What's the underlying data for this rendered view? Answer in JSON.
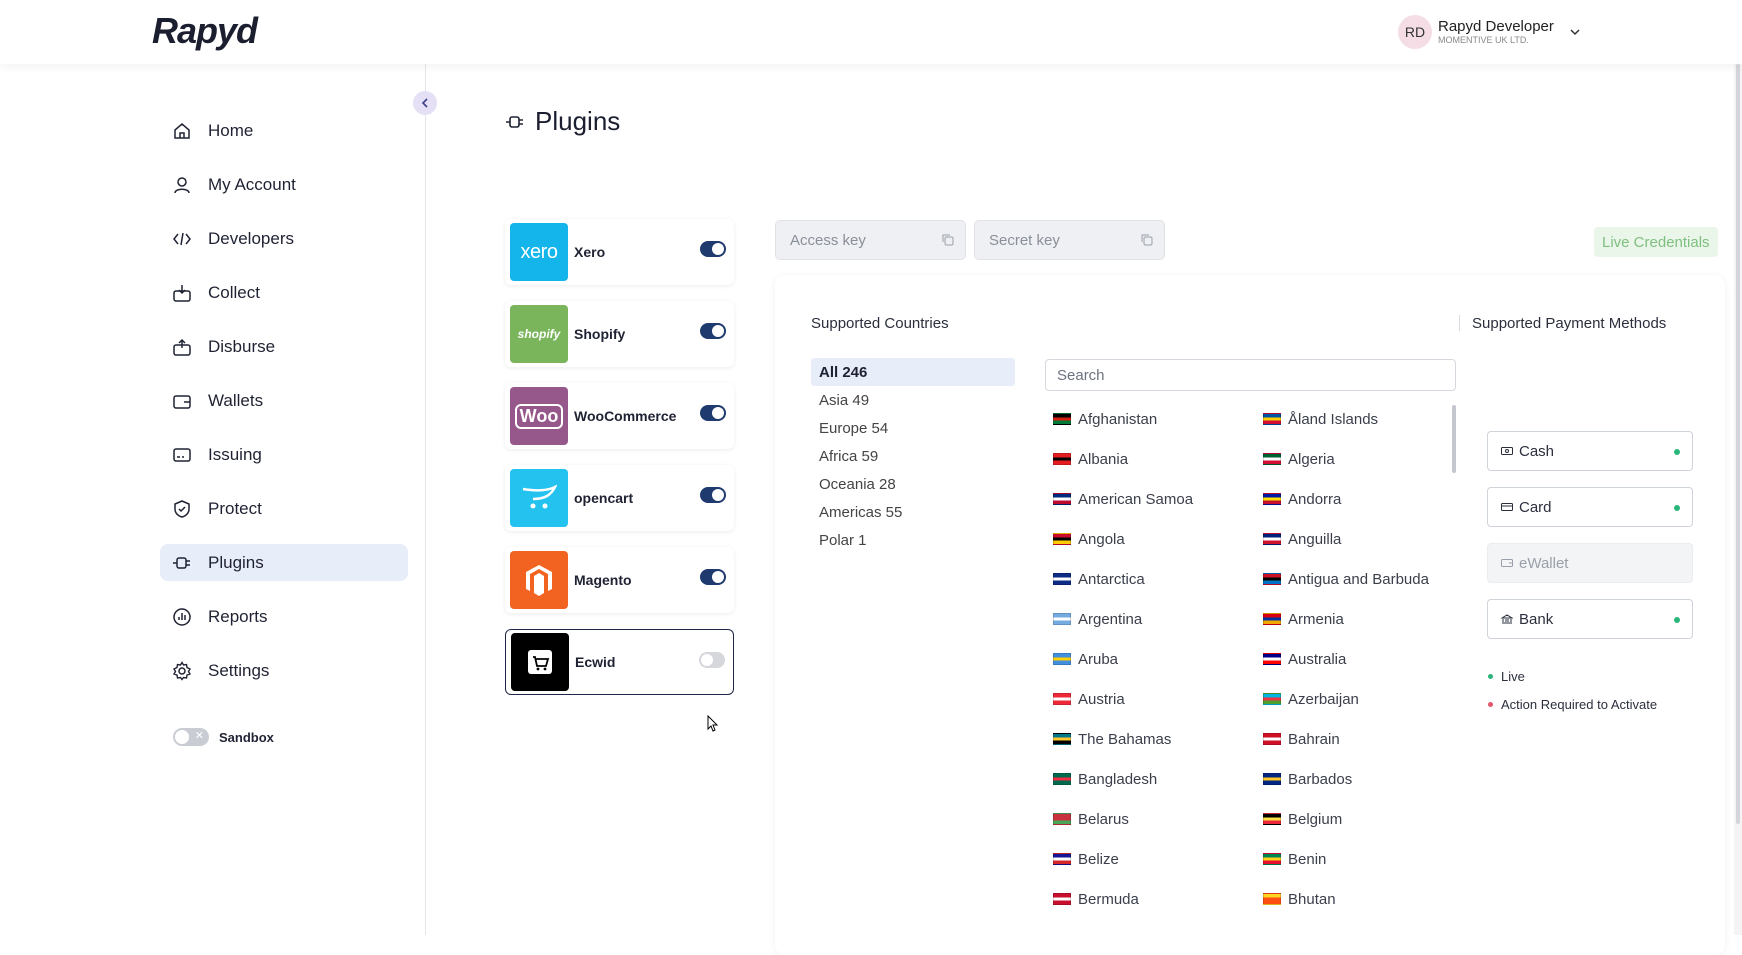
{
  "header": {
    "logo": "Rapyd",
    "user": {
      "initials": "RD",
      "name": "Rapyd Developer",
      "org": "MOMENTIVE UK LTD."
    }
  },
  "sidebar": {
    "items": [
      {
        "label": "Home",
        "icon": "home-icon",
        "active": false
      },
      {
        "label": "My Account",
        "icon": "user-icon",
        "active": false
      },
      {
        "label": "Developers",
        "icon": "code-icon",
        "active": false
      },
      {
        "label": "Collect",
        "icon": "collect-icon",
        "active": false
      },
      {
        "label": "Disburse",
        "icon": "disburse-icon",
        "active": false
      },
      {
        "label": "Wallets",
        "icon": "wallet-icon",
        "active": false
      },
      {
        "label": "Issuing",
        "icon": "card-icon",
        "active": false
      },
      {
        "label": "Protect",
        "icon": "shield-icon",
        "active": false
      },
      {
        "label": "Plugins",
        "icon": "plug-icon",
        "active": true
      },
      {
        "label": "Reports",
        "icon": "chart-icon",
        "active": false
      },
      {
        "label": "Settings",
        "icon": "gear-icon",
        "active": false
      }
    ],
    "sandbox_label": "Sandbox",
    "sandbox_enabled": false
  },
  "main": {
    "title": "Plugins",
    "plugins": [
      {
        "name": "Xero",
        "logo_text": "xero",
        "color": "#13b5ea",
        "enabled": true
      },
      {
        "name": "Shopify",
        "logo_text": "shopify",
        "color": "#7ab55c",
        "enabled": true
      },
      {
        "name": "WooCommerce",
        "logo_text": "Woo",
        "color": "#96588a",
        "enabled": true
      },
      {
        "name": "opencart",
        "logo_text": "",
        "color": "#23c2ef",
        "enabled": true
      },
      {
        "name": "Magento",
        "logo_text": "",
        "color": "#f26322",
        "enabled": true
      },
      {
        "name": "Ecwid",
        "logo_text": "",
        "color": "#000000",
        "enabled": false,
        "selected": true
      }
    ],
    "access_key_placeholder": "Access key",
    "secret_key_placeholder": "Secret key",
    "live_credentials": "Live Credentials",
    "supported_countries_title": "Supported Countries",
    "supported_methods_title": "Supported Payment Methods",
    "regions": [
      {
        "label": "All 246",
        "active": true
      },
      {
        "label": "Asia 49",
        "active": false
      },
      {
        "label": "Europe 54",
        "active": false
      },
      {
        "label": "Africa 59",
        "active": false
      },
      {
        "label": "Oceania 28",
        "active": false
      },
      {
        "label": "Americas 55",
        "active": false
      },
      {
        "label": "Polar 1",
        "active": false
      }
    ],
    "search_placeholder": "Search",
    "countries": [
      "Afghanistan",
      "Åland Islands",
      "Albania",
      "Algeria",
      "American Samoa",
      "Andorra",
      "Angola",
      "Anguilla",
      "Antarctica",
      "Antigua and Barbuda",
      "Argentina",
      "Armenia",
      "Aruba",
      "Australia",
      "Austria",
      "Azerbaijan",
      "The Bahamas",
      "Bahrain",
      "Bangladesh",
      "Barbados",
      "Belarus",
      "Belgium",
      "Belize",
      "Benin",
      "Bermuda",
      "Bhutan"
    ],
    "payment_methods": [
      {
        "label": "Cash",
        "icon": "cash-icon",
        "status": "live"
      },
      {
        "label": "Card",
        "icon": "card-icon",
        "status": "live"
      },
      {
        "label": "eWallet",
        "icon": "wallet-icon",
        "status": "disabled"
      },
      {
        "label": "Bank",
        "icon": "bank-icon",
        "status": "live"
      }
    ],
    "legend": [
      {
        "label": "Live",
        "color": "#2bb57a"
      },
      {
        "label": "Action Required to Activate",
        "color": "#e0566b"
      }
    ]
  }
}
